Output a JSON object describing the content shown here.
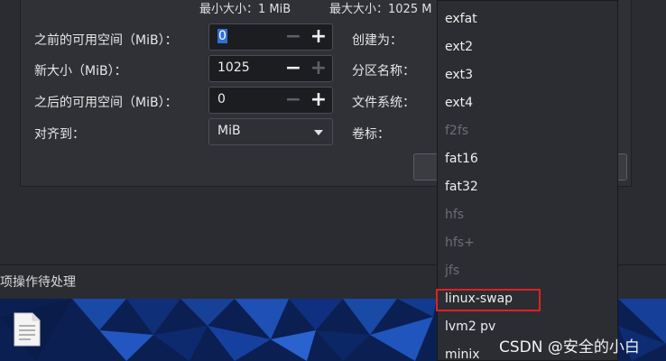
{
  "dialog": {
    "min_size": "最小大小：1 MiB",
    "max_size": "最大大小：1025 M",
    "fields": {
      "free_before_label": "之前的可用空间（MiB）：",
      "free_before_value": "0",
      "new_size_label": "新大小（MiB）：",
      "new_size_value": "1025",
      "free_after_label": "之后的可用空间（MiB）：",
      "free_after_value": "0",
      "align_label": "对齐到：",
      "align_value": "MiB"
    },
    "right_labels": {
      "create_as": "创建为：",
      "partition_name": "分区名称：",
      "filesystem": "文件系统：",
      "label": "卷标："
    },
    "spin_symbols": {
      "minus": "−",
      "plus": "+"
    }
  },
  "pending_bar": {
    "text": "项操作待处理"
  },
  "filesystem_dropdown": {
    "options": [
      {
        "label": "exfat",
        "enabled": true
      },
      {
        "label": "ext2",
        "enabled": true
      },
      {
        "label": "ext3",
        "enabled": true
      },
      {
        "label": "ext4",
        "enabled": true
      },
      {
        "label": "f2fs",
        "enabled": false
      },
      {
        "label": "fat16",
        "enabled": true
      },
      {
        "label": "fat32",
        "enabled": true
      },
      {
        "label": "hfs",
        "enabled": false
      },
      {
        "label": "hfs+",
        "enabled": false
      },
      {
        "label": "jfs",
        "enabled": false
      },
      {
        "label": "linux-swap",
        "enabled": true
      },
      {
        "label": "lvm2 pv",
        "enabled": true
      },
      {
        "label": "minix",
        "enabled": true
      }
    ],
    "highlighted": "linux-swap"
  },
  "watermark": "CSDN @安全的小白",
  "colors": {
    "highlight_border": "#e02020",
    "selection": "#2f6fd6"
  },
  "icons": {
    "file": "document-file-icon",
    "dropdown_arrow": "chevron-down-icon"
  }
}
